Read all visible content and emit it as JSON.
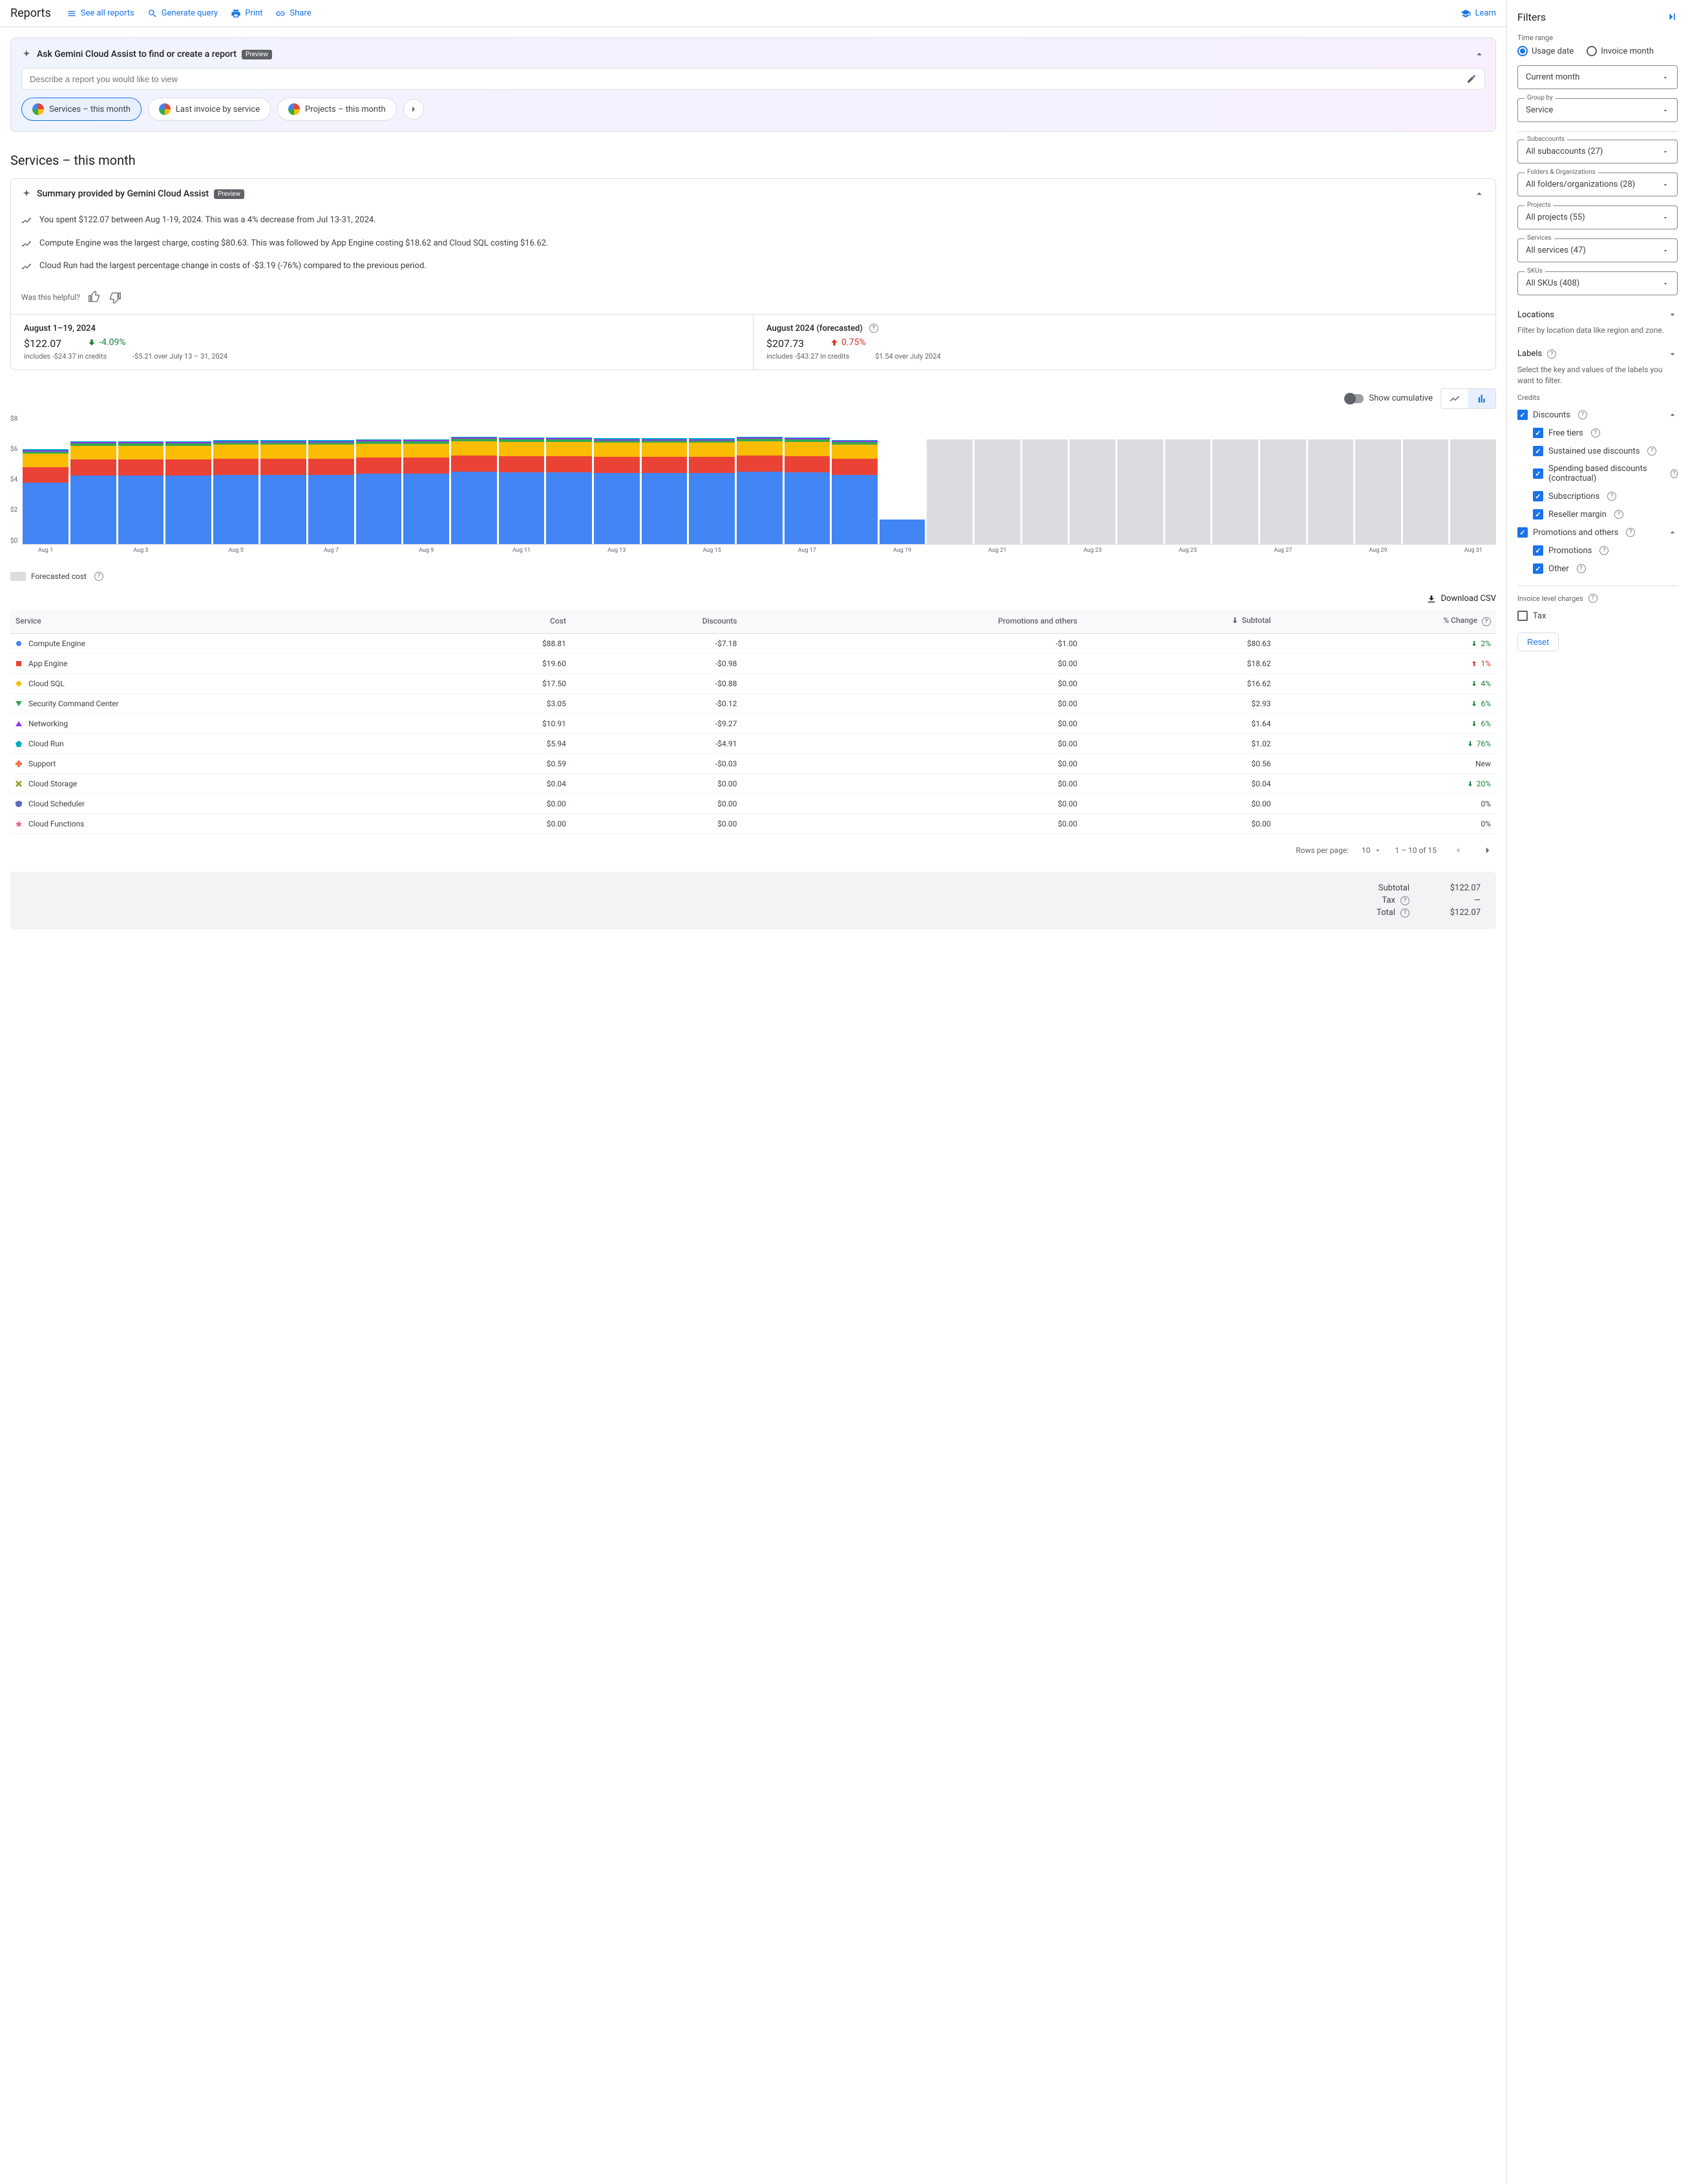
{
  "header": {
    "title": "Reports",
    "see_all": "See all reports",
    "generate": "Generate query",
    "print": "Print",
    "share": "Share",
    "learn": "Learn"
  },
  "filters_title": "Filters",
  "gemini": {
    "title": "Ask Gemini Cloud Assist to find or create a report",
    "preview": "Preview",
    "placeholder": "Describe a report you would like to view",
    "chips": [
      "Services – this month",
      "Last invoice by service",
      "Projects – this month"
    ]
  },
  "page_title": "Services – this month",
  "summary": {
    "title": "Summary provided by Gemini Cloud Assist",
    "preview": "Preview",
    "bullets": [
      "You spent $122.07 between Aug 1-19, 2024. This was a 4% decrease from Jul 13-31, 2024.",
      "Compute Engine was the largest charge, costing $80.63. This was followed by App Engine costing $18.62 and Cloud SQL costing $16.62.",
      "Cloud Run had the largest percentage change in costs of -$3.19 (-76%) compared to the previous period."
    ],
    "helpful": "Was this helpful?"
  },
  "stats": {
    "left": {
      "period": "August 1–19, 2024",
      "value": "$122.07",
      "credits": "includes -$24.37 in credits",
      "change_pct": "-4.09%",
      "change_note": "-$5.21 over July 13 – 31, 2024"
    },
    "right": {
      "period": "August 2024 (forecasted)",
      "value": "$207.73",
      "credits": "includes -$43.27 in credits",
      "change_pct": "0.75%",
      "change_note": "$1.54 over July 2024"
    }
  },
  "chart_controls": {
    "cumulative": "Show cumulative"
  },
  "chart_legend": {
    "forecast": "Forecasted cost"
  },
  "download": "Download CSV",
  "table": {
    "headers": [
      "Service",
      "Cost",
      "Discounts",
      "Promotions and others",
      "Subtotal",
      "% Change"
    ],
    "rows": [
      {
        "color": "#4285f4",
        "shape": "circle",
        "service": "Compute Engine",
        "cost": "$88.81",
        "disc": "-$7.18",
        "promo": "-$1.00",
        "sub": "$80.63",
        "dir": "down",
        "pct": "2%"
      },
      {
        "color": "#ea4335",
        "shape": "square",
        "service": "App Engine",
        "cost": "$19.60",
        "disc": "-$0.98",
        "promo": "$0.00",
        "sub": "$18.62",
        "dir": "up",
        "pct": "1%"
      },
      {
        "color": "#fbbc04",
        "shape": "diamond",
        "service": "Cloud SQL",
        "cost": "$17.50",
        "disc": "-$0.88",
        "promo": "$0.00",
        "sub": "$16.62",
        "dir": "down",
        "pct": "4%"
      },
      {
        "color": "#34a853",
        "shape": "triangle-down",
        "service": "Security Command Center",
        "cost": "$3.05",
        "disc": "-$0.12",
        "promo": "$0.00",
        "sub": "$2.93",
        "dir": "down",
        "pct": "6%"
      },
      {
        "color": "#9334e6",
        "shape": "triangle-up",
        "service": "Networking",
        "cost": "$10.91",
        "disc": "-$9.27",
        "promo": "$0.00",
        "sub": "$1.64",
        "dir": "down",
        "pct": "6%"
      },
      {
        "color": "#00acc1",
        "shape": "pentagon",
        "service": "Cloud Run",
        "cost": "$5.94",
        "disc": "-$4.91",
        "promo": "$0.00",
        "sub": "$1.02",
        "dir": "down",
        "pct": "76%"
      },
      {
        "color": "#ff7043",
        "shape": "plus",
        "service": "Support",
        "cost": "$0.59",
        "disc": "-$0.03",
        "promo": "$0.00",
        "sub": "$0.56",
        "dir": "",
        "pct": "New"
      },
      {
        "color": "#9e9d24",
        "shape": "cross",
        "service": "Cloud Storage",
        "cost": "$0.04",
        "disc": "$0.00",
        "promo": "$0.00",
        "sub": "$0.04",
        "dir": "down",
        "pct": "20%"
      },
      {
        "color": "#5c6bc0",
        "shape": "shield",
        "service": "Cloud Scheduler",
        "cost": "$0.00",
        "disc": "$0.00",
        "promo": "$0.00",
        "sub": "$0.00",
        "dir": "",
        "pct": "0%"
      },
      {
        "color": "#f06292",
        "shape": "star",
        "service": "Cloud Functions",
        "cost": "$0.00",
        "disc": "$0.00",
        "promo": "$0.00",
        "sub": "$0.00",
        "dir": "",
        "pct": "0%"
      }
    ]
  },
  "pagination": {
    "rows_label": "Rows per page:",
    "rows_value": "10",
    "range": "1 – 10 of 15"
  },
  "totals": {
    "subtotal_label": "Subtotal",
    "subtotal_value": "$122.07",
    "tax_label": "Tax",
    "tax_value": "—",
    "total_label": "Total",
    "total_value": "$122.07"
  },
  "filters": {
    "time_range": "Time range",
    "usage_date": "Usage date",
    "invoice_month": "Invoice month",
    "current_month": "Current month",
    "group_by_label": "Group by",
    "group_by_value": "Service",
    "subaccounts_label": "Subaccounts",
    "subaccounts_value": "All subaccounts (27)",
    "folders_label": "Folders & Organizations",
    "folders_value": "All folders/organizations (28)",
    "projects_label": "Projects",
    "projects_value": "All projects (55)",
    "services_label": "Services",
    "services_value": "All services (47)",
    "skus_label": "SKUs",
    "skus_value": "All SKUs (408)",
    "locations": "Locations",
    "locations_desc": "Filter by location data like region and zone.",
    "labels": "Labels",
    "labels_desc": "Select the key and values of the labels you want to filter.",
    "credits": "Credits",
    "discounts": "Discounts",
    "free_tiers": "Free tiers",
    "sustained": "Sustained use discounts",
    "spending": "Spending based discounts (contractual)",
    "subscriptions": "Subscriptions",
    "reseller": "Reseller margin",
    "promotions_others": "Promotions and others",
    "promotions": "Promotions",
    "other": "Other",
    "invoice_level": "Invoice level charges",
    "tax": "Tax",
    "reset": "Reset"
  },
  "chart_data": {
    "type": "bar",
    "ylabel": "$",
    "ylim": [
      0,
      8
    ],
    "y_ticks": [
      "$8",
      "$6",
      "$4",
      "$2",
      "$0"
    ],
    "x_labels": [
      "Aug 1",
      "",
      "Aug 3",
      "",
      "Aug 5",
      "",
      "Aug 7",
      "",
      "Aug 9",
      "",
      "Aug 11",
      "",
      "Aug 13",
      "",
      "Aug 15",
      "",
      "Aug 17",
      "",
      "Aug 19",
      "",
      "Aug 21",
      "",
      "Aug 23",
      "",
      "Aug 25",
      "",
      "Aug 27",
      "",
      "Aug 29",
      "",
      "Aug 31"
    ],
    "series_colors": {
      "compute": "#4285f4",
      "appengine": "#ea4335",
      "sql": "#fbbc04",
      "sec": "#34a853",
      "net": "#9334e6",
      "run": "#00acc1"
    },
    "actual_days": 19,
    "forecast_days": 12,
    "stacks": [
      {
        "compute": 3.8,
        "appengine": 0.95,
        "sql": 0.85,
        "sec": 0.15,
        "net": 0.08,
        "run": 0.05
      },
      {
        "compute": 4.25,
        "appengine": 0.98,
        "sql": 0.88,
        "sec": 0.15,
        "net": 0.08,
        "run": 0.05
      },
      {
        "compute": 4.25,
        "appengine": 0.98,
        "sql": 0.88,
        "sec": 0.15,
        "net": 0.08,
        "run": 0.05
      },
      {
        "compute": 4.25,
        "appengine": 0.98,
        "sql": 0.88,
        "sec": 0.15,
        "net": 0.08,
        "run": 0.05
      },
      {
        "compute": 4.3,
        "appengine": 0.98,
        "sql": 0.88,
        "sec": 0.15,
        "net": 0.08,
        "run": 0.05
      },
      {
        "compute": 4.3,
        "appengine": 0.98,
        "sql": 0.88,
        "sec": 0.15,
        "net": 0.08,
        "run": 0.05
      },
      {
        "compute": 4.3,
        "appengine": 0.98,
        "sql": 0.88,
        "sec": 0.15,
        "net": 0.08,
        "run": 0.05
      },
      {
        "compute": 4.35,
        "appengine": 1.0,
        "sql": 0.88,
        "sec": 0.15,
        "net": 0.08,
        "run": 0.05
      },
      {
        "compute": 4.35,
        "appengine": 1.0,
        "sql": 0.88,
        "sec": 0.15,
        "net": 0.08,
        "run": 0.05
      },
      {
        "compute": 4.5,
        "appengine": 1.0,
        "sql": 0.88,
        "sec": 0.15,
        "net": 0.08,
        "run": 0.05
      },
      {
        "compute": 4.45,
        "appengine": 1.0,
        "sql": 0.88,
        "sec": 0.15,
        "net": 0.08,
        "run": 0.05
      },
      {
        "compute": 4.45,
        "appengine": 1.0,
        "sql": 0.88,
        "sec": 0.15,
        "net": 0.08,
        "run": 0.05
      },
      {
        "compute": 4.4,
        "appengine": 1.0,
        "sql": 0.88,
        "sec": 0.15,
        "net": 0.08,
        "run": 0.05
      },
      {
        "compute": 4.4,
        "appengine": 1.0,
        "sql": 0.88,
        "sec": 0.15,
        "net": 0.08,
        "run": 0.05
      },
      {
        "compute": 4.4,
        "appengine": 1.0,
        "sql": 0.88,
        "sec": 0.15,
        "net": 0.08,
        "run": 0.05
      },
      {
        "compute": 4.5,
        "appengine": 1.0,
        "sql": 0.88,
        "sec": 0.15,
        "net": 0.08,
        "run": 0.05
      },
      {
        "compute": 4.45,
        "appengine": 1.0,
        "sql": 0.88,
        "sec": 0.15,
        "net": 0.08,
        "run": 0.05
      },
      {
        "compute": 4.3,
        "appengine": 1.0,
        "sql": 0.88,
        "sec": 0.15,
        "net": 0.08,
        "run": 0.05
      },
      {
        "compute": 1.5,
        "appengine": 0.0,
        "sql": 0.0,
        "sec": 0.0,
        "net": 0.0,
        "run": 0.0
      }
    ],
    "forecast_value": 6.5
  }
}
